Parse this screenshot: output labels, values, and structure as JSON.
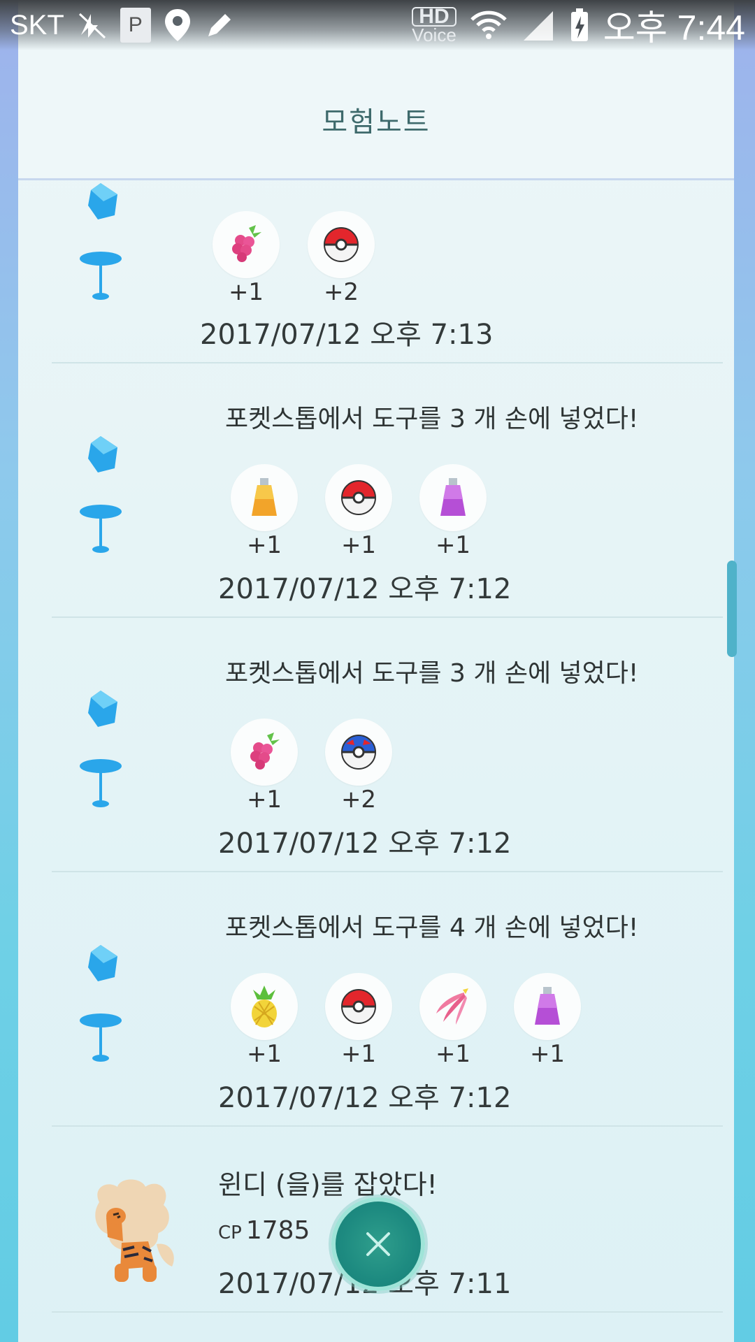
{
  "status_bar": {
    "carrier": "SKT",
    "hd_label": "HD",
    "voice_label": "Voice",
    "time": "오후 7:44"
  },
  "header": {
    "title": "모험노트"
  },
  "entries": [
    {
      "title": "",
      "items": [
        {
          "icon": "raspberry-icon",
          "count": "+1"
        },
        {
          "icon": "pokeball-icon",
          "count": "+2"
        }
      ],
      "date": "2017/07/12 오후 7:13"
    },
    {
      "title": "포켓스톱에서 도구를 3 개 손에 넣었다!",
      "items": [
        {
          "icon": "hyper-potion-icon",
          "count": "+1"
        },
        {
          "icon": "pokeball-icon",
          "count": "+1"
        },
        {
          "icon": "revive-potion-icon",
          "count": "+1"
        }
      ],
      "date": "2017/07/12 오후 7:12"
    },
    {
      "title": "포켓스톱에서 도구를 3 개 손에 넣었다!",
      "items": [
        {
          "icon": "raspberry-icon",
          "count": "+1"
        },
        {
          "icon": "greatball-icon",
          "count": "+2"
        }
      ],
      "date": "2017/07/12 오후 7:12"
    },
    {
      "title": "포켓스톱에서 도구를 4 개 손에 넣었다!",
      "items": [
        {
          "icon": "pinap-berry-icon",
          "count": "+1"
        },
        {
          "icon": "pokeball-icon",
          "count": "+1"
        },
        {
          "icon": "nanab-berry-icon",
          "count": "+1"
        },
        {
          "icon": "revive-potion-icon",
          "count": "+1"
        }
      ],
      "date": "2017/07/12 오후 7:12"
    }
  ],
  "catch_entry": {
    "title": "윈디 (을)를 잡았다!",
    "cp_label": "CP",
    "cp_value": "1785",
    "date": "2017/07/12 오후 7:11"
  },
  "colors": {
    "accent": "#1d8a80",
    "pokestop_blue": "#2aa6ea"
  }
}
